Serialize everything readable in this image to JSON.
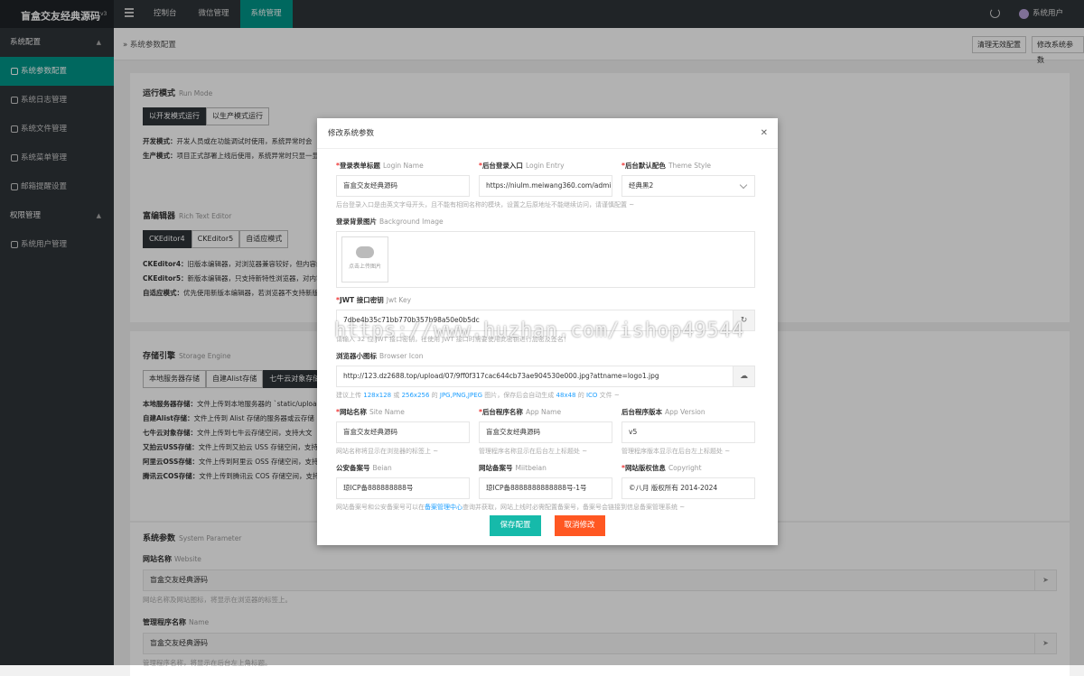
{
  "topbar": {
    "logo": "盲盒交友经典源码",
    "logo_version": "v3",
    "nav": [
      "控制台",
      "微信管理",
      "系统管理"
    ],
    "user": "系统用户"
  },
  "sidebar": {
    "groups": [
      {
        "label": "系统配置",
        "items": [
          "系统参数配置",
          "系统日志管理",
          "系统文件管理",
          "系统菜单管理",
          "邮箱提醒设置"
        ]
      },
      {
        "label": "权限管理",
        "items": [
          "系统用户管理"
        ]
      }
    ]
  },
  "page": {
    "breadcrumb": "系统参数配置",
    "btn_clear": "清理无效配置",
    "btn_edit": "修改系统参数"
  },
  "run_mode": {
    "title": "运行模式",
    "title_en": "Run Mode",
    "options": [
      "以开发模式运行",
      "以生产模式运行"
    ],
    "desc1_label": "开发模式：",
    "desc1": "开发人员或在功能调试时使用，系统异常时会",
    "desc2_label": "生产模式：",
    "desc2": "项目正式部署上线后使用，系统异常时只显一显"
  },
  "editor": {
    "title": "富编辑器",
    "title_en": "Rich Text Editor",
    "options": [
      "CKEditor4",
      "CKEditor5",
      "自适应模式"
    ],
    "d1_label": "CKEditor4：",
    "d1": "旧版本编辑器，对浏览器兼容较好，但内容编",
    "d2_label": "CKEditor5：",
    "d2": "新版本编辑器，只支持新特性浏览器，对内容",
    "d3_label": "自适应模式：",
    "d3": "优先使用新版本编辑器，若浏览器不支持新版"
  },
  "storage": {
    "title": "存储引擎",
    "title_en": "Storage Engine",
    "options": [
      "本地服务器存储",
      "自建Alist存储",
      "七牛云对象存储"
    ],
    "lines": [
      {
        "k": "本地服务器存储：",
        "v": "文件上传到本地服务器的 `static/upload"
      },
      {
        "k": "自建Alist存储：",
        "v": "文件上传到 Alist 存储的服务器或云存储"
      },
      {
        "k": "七牛云对象存储：",
        "v": "文件上传到七牛云存储空间，支持大文"
      },
      {
        "k": "又拍云USS存储：",
        "v": "文件上传到又拍云 USS 存储空间，支持"
      },
      {
        "k": "阿里云OSS存储：",
        "v": "文件上传到阿里云 OSS 存储空间，支持"
      },
      {
        "k": "腾讯云COS存储：",
        "v": "文件上传到腾讯云 COS 存储空间，支持"
      }
    ]
  },
  "sysparams": {
    "title": "系统参数",
    "title_en": "System Parameter",
    "f1_label": "网站名称",
    "f1_en": "Website",
    "f1_value": "盲盒交友经典源码",
    "f1_help": "网站名称及网站图标，将显示在浏览器的标签上。",
    "f2_label": "管理程序名称",
    "f2_en": "Name",
    "f2_value": "盲盒交友经典源码",
    "f2_help": "管理程序名称，将显示在后台左上角标题。"
  },
  "modal": {
    "title": "修改系统参数",
    "login_name": {
      "label": "登录表单标题",
      "en": "Login Name",
      "value": "盲盒交友经典源码"
    },
    "login_entry": {
      "label": "后台登录入口",
      "en": "Login Entry",
      "value": "https://niulm.meiwang360.com/admin"
    },
    "theme": {
      "label": "后台默认配色",
      "en": "Theme Style",
      "value": "经典黑2"
    },
    "help1": "后台登录入口是由英文字母开头，且不能有相同名称的模块，设置之后原地址不能继续访问，请谨慎配置 ~",
    "bg": {
      "label": "登录背景图片",
      "en": "Background Image",
      "upload": "点击上传图片"
    },
    "jwt": {
      "label": "JWT 接口密钥",
      "en": "Jwt Key",
      "value": "7dbe4b35c71bb770b357b98a50e0b5dc"
    },
    "jwt_help": "请输入 32 位 JWT 接口密钥，在使用 JWT 接口时需要使用此密钥进行加密及签名！",
    "icon": {
      "label": "浏览器小图标",
      "en": "Browser Icon",
      "value": "http://123.dz2688.top/upload/07/9ff0f317cac644cb73ae904530e000.jpg?attname=logo1.jpg"
    },
    "icon_help_a": "建议上传 ",
    "icon_help_b": "128x128",
    "icon_help_c": " 或 ",
    "icon_help_d": "256x256",
    "icon_help_e": " 的 ",
    "icon_help_f": "JPG,PNG,JPEG",
    "icon_help_g": " 图片，保存后会自动生成 ",
    "icon_help_h": "48x48",
    "icon_help_i": " 的 ",
    "icon_help_j": "ICO",
    "icon_help_k": " 文件 ~",
    "site_name": {
      "label": "网站名称",
      "en": "Site Name",
      "value": "盲盒交友经典源码",
      "help": "网站名称将显示在浏览器的标签上 ~"
    },
    "app_name": {
      "label": "后台程序名称",
      "en": "App Name",
      "value": "盲盒交友经典源码",
      "help": "管理程序名称显示在后台左上标题处 ~"
    },
    "app_version": {
      "label": "后台程序版本",
      "en": "App Version",
      "value": "v5",
      "help": "管理程序版本显示在后台左上标题处 ~"
    },
    "beian": {
      "label": "公安备案号",
      "en": "Beian",
      "value": "琼ICP备888888888号"
    },
    "miitbeian": {
      "label": "网站备案号",
      "en": "Miitbeian",
      "value": "琼ICP备8888888888888号-1号"
    },
    "copyright": {
      "label": "网站版权信息",
      "en": "Copyright",
      "value": "©八月 版权所有 2014-2024"
    },
    "help_last_a": "网站备案号和公安备案号可以在",
    "help_last_b": "备案管理中心",
    "help_last_c": "查询并获取，网站上线时必需配置备案号，备案号会链接到信息备案管理系统 ~",
    "btn_save": "保存配置",
    "btn_cancel": "取消修改"
  },
  "watermark": "https://www.huzhan.com/ishop49544",
  "colors": {
    "accent": "#009688",
    "cancel": "#ff5722",
    "dark": "#2f3439"
  }
}
